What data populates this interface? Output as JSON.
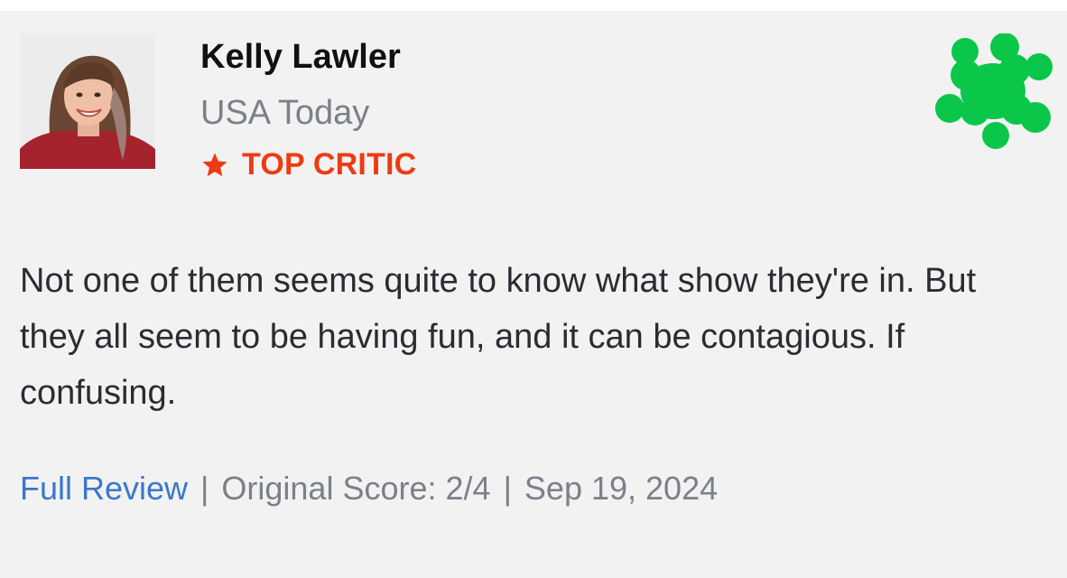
{
  "review": {
    "critic_name": "Kelly Lawler",
    "publication": "USA Today",
    "badge": "TOP CRITIC",
    "quote": "Not one of them seems quite to know what show they're in. But they all seem to be having fun, and it can be contagious. If confusing.",
    "full_review_label": "Full Review",
    "separator": "|",
    "original_score": "Original Score: 2/4",
    "date": "Sep 19, 2024"
  },
  "icons": {
    "badge_icon": "star-icon",
    "rating_icon": "fresh-splat-icon"
  },
  "colors": {
    "background": "#f2f2f2",
    "top_critic": "#ec3b13",
    "fresh_green": "#0ac74a",
    "link": "#3a78c9",
    "muted": "#7b8089"
  }
}
